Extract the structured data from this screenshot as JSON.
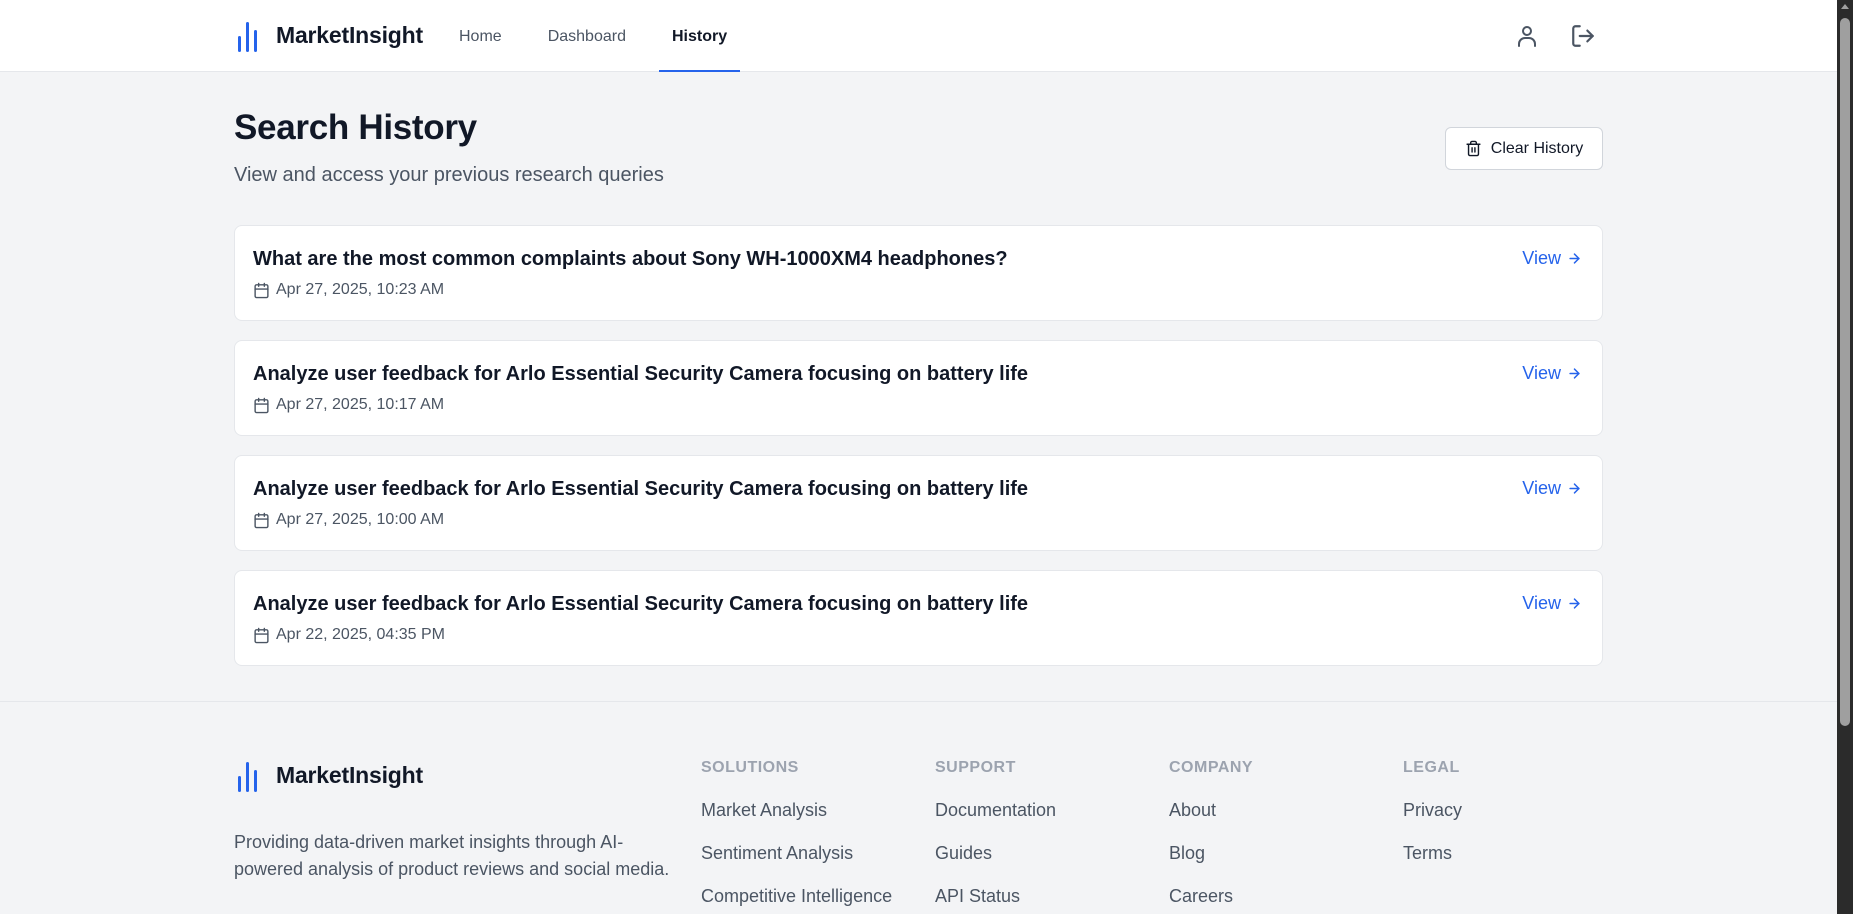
{
  "brand": {
    "name": "MarketInsight"
  },
  "nav": {
    "items": [
      "Home",
      "Dashboard",
      "History"
    ],
    "active": "History"
  },
  "page": {
    "title": "Search History",
    "subtitle": "View and access your previous research queries",
    "clear_label": "Clear History"
  },
  "history": [
    {
      "query": "What are the most common complaints about Sony WH-1000XM4 headphones?",
      "date": "Apr 27, 2025, 10:23 AM",
      "action": "View"
    },
    {
      "query": "Analyze user feedback for Arlo Essential Security Camera focusing on battery life",
      "date": "Apr 27, 2025, 10:17 AM",
      "action": "View"
    },
    {
      "query": "Analyze user feedback for Arlo Essential Security Camera focusing on battery life",
      "date": "Apr 27, 2025, 10:00 AM",
      "action": "View"
    },
    {
      "query": "Analyze user feedback for Arlo Essential Security Camera focusing on battery life",
      "date": "Apr 22, 2025, 04:35 PM",
      "action": "View"
    }
  ],
  "footer": {
    "description": "Providing data-driven market insights through AI-powered analysis of product reviews and social media.",
    "columns": [
      {
        "heading": "SOLUTIONS",
        "links": [
          "Market Analysis",
          "Sentiment Analysis",
          "Competitive Intelligence"
        ]
      },
      {
        "heading": "SUPPORT",
        "links": [
          "Documentation",
          "Guides",
          "API Status"
        ]
      },
      {
        "heading": "COMPANY",
        "links": [
          "About",
          "Blog",
          "Careers"
        ]
      },
      {
        "heading": "LEGAL",
        "links": [
          "Privacy",
          "Terms"
        ]
      }
    ]
  },
  "colors": {
    "accent": "#2563eb",
    "background": "#f3f4f6",
    "card": "#ffffff"
  },
  "icons": {
    "user": "user-icon",
    "logout": "logout-icon",
    "trash": "trash-icon",
    "calendar": "calendar-icon",
    "arrow": "arrow-right-icon",
    "logo": "bar-chart-icon"
  }
}
